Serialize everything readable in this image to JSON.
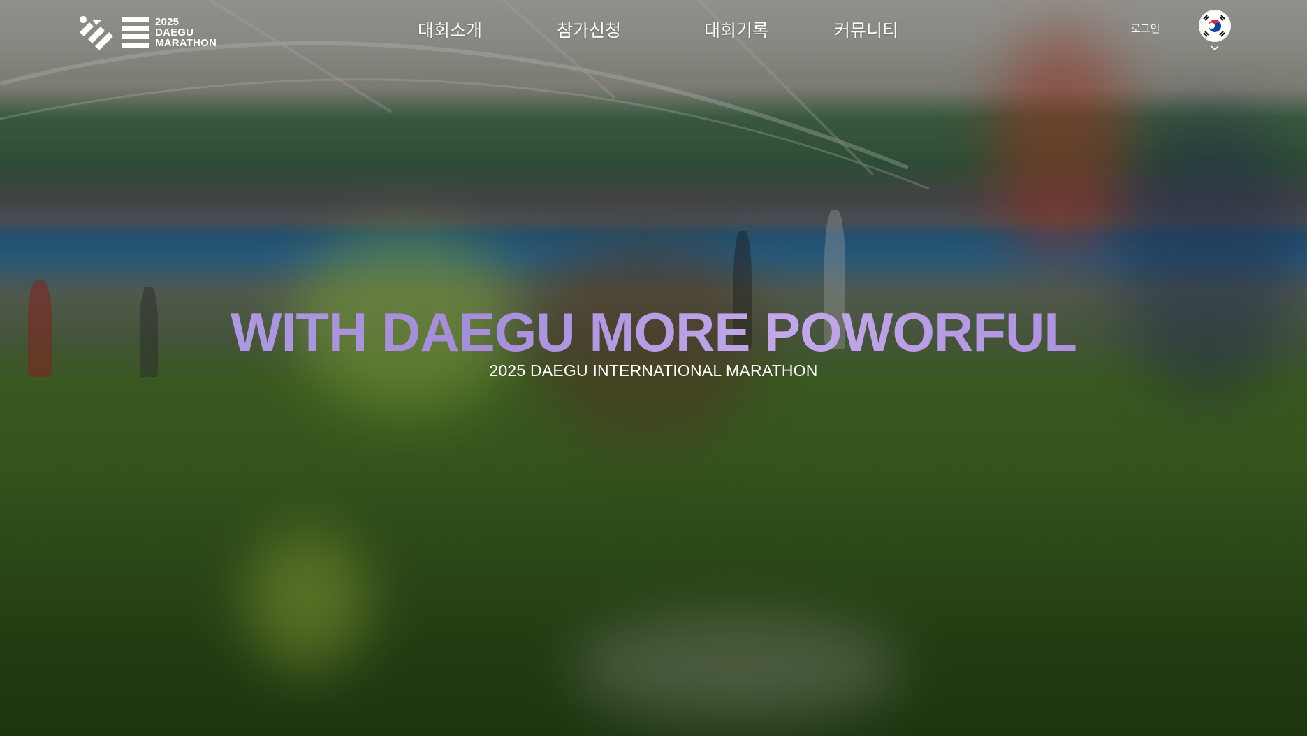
{
  "brand": {
    "logo_line1": "2025",
    "logo_line2": "DAEGU",
    "logo_line3": "MARATHON",
    "logo_icon": "daegu-marathon-logo-icon"
  },
  "nav": {
    "items": [
      {
        "label": "대회소개"
      },
      {
        "label": "참가신청"
      },
      {
        "label": "대회기록"
      },
      {
        "label": "커뮤니티"
      }
    ]
  },
  "account": {
    "login_label": "로그인"
  },
  "language": {
    "icon": "korea-flag-icon",
    "dropdown_icon": "chevron-down-icon"
  },
  "hero": {
    "headline": "WITH DAEGU MORE POWORFUL",
    "subline": "2025 DAEGU INTERNATIONAL MARATHON",
    "headline_color": "#a58cdc",
    "text_color": "#ffffff"
  }
}
